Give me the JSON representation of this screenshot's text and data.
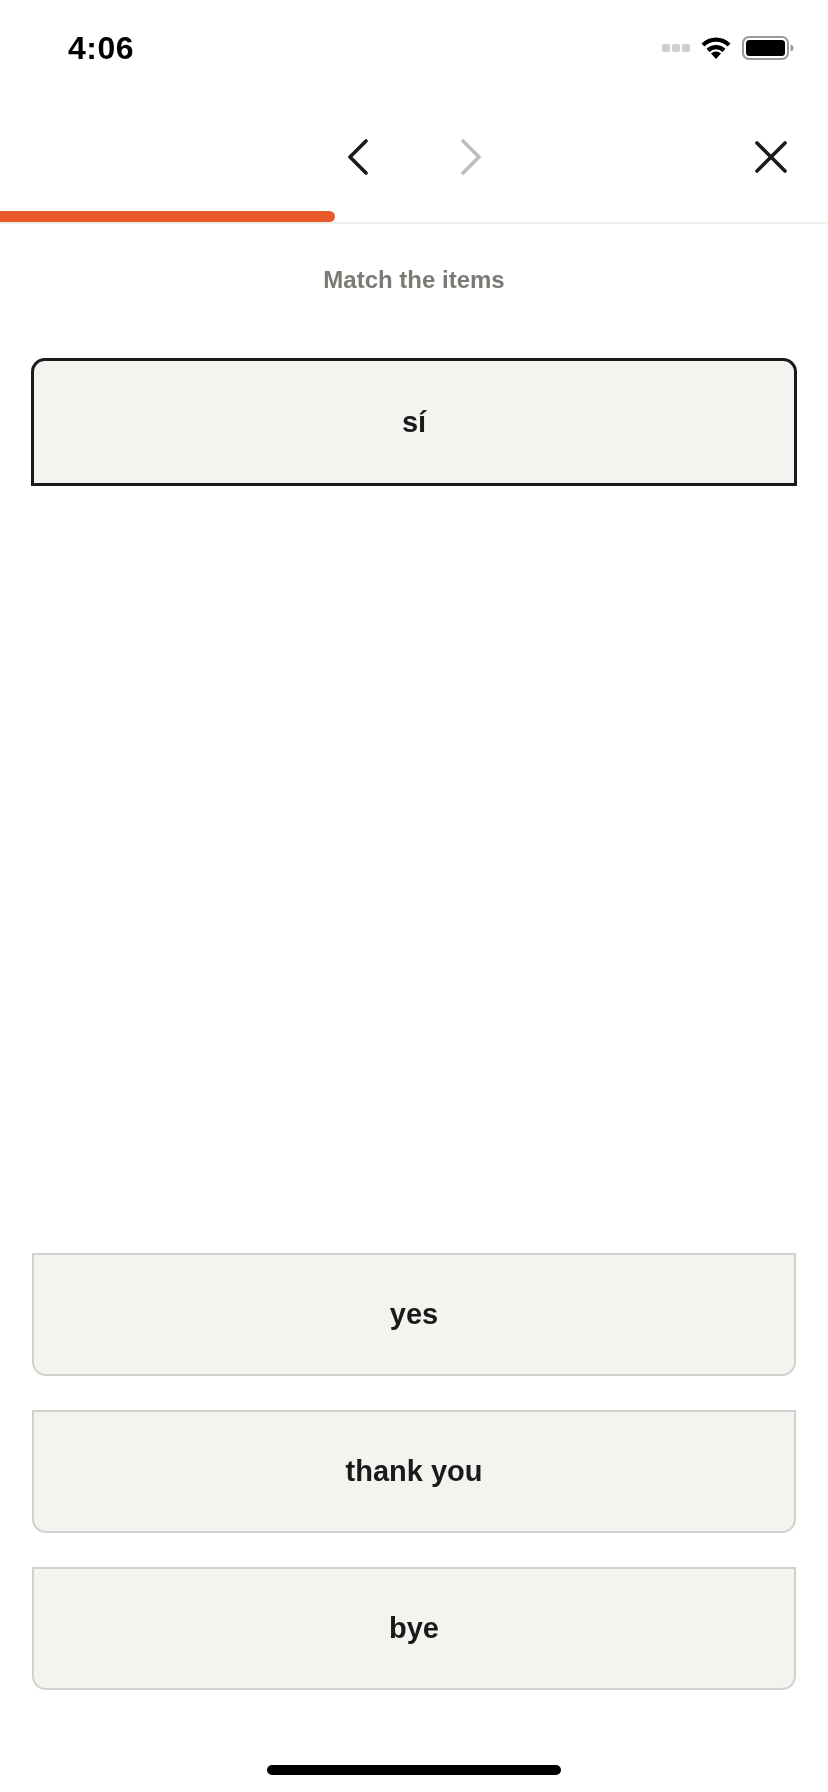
{
  "status_bar": {
    "time": "4:06"
  },
  "nav": {
    "back": {
      "disabled": false
    },
    "forward": {
      "disabled": true
    }
  },
  "progress": {
    "level": 0.405
  },
  "prompt": "Match the items",
  "terms": [
    {
      "text": "sí",
      "active": true
    }
  ],
  "options": [
    {
      "text": "yes",
      "selected": false
    },
    {
      "text": "thank you",
      "selected": false
    },
    {
      "text": "bye",
      "selected": false
    }
  ]
}
